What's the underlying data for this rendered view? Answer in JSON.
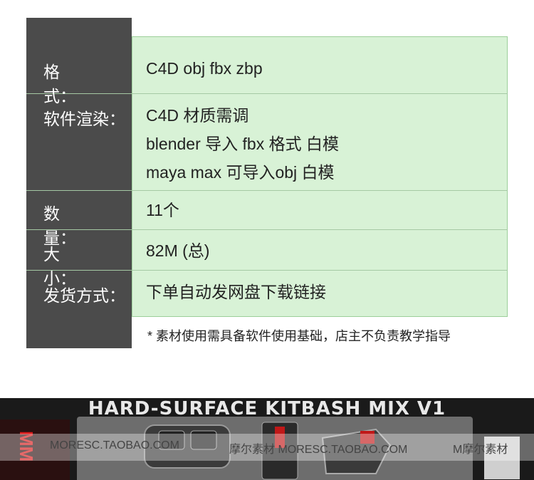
{
  "spec_table": {
    "rows": [
      {
        "label_key": "格",
        "label_colon": "式：",
        "lines": [
          "C4D   obj   fbx   zbp"
        ]
      },
      {
        "label_key": "软件渲染",
        "label_colon": "：",
        "lines": [
          "C4D  材质需调",
          "blender  导入 fbx 格式 白模",
          "maya  max  可导入obj  白模"
        ]
      },
      {
        "label_key": "数",
        "label_colon": "量：",
        "lines": [
          "11个"
        ]
      },
      {
        "label_key": "大",
        "label_colon": "小：",
        "lines": [
          "82M (总)"
        ]
      },
      {
        "label_key": "发货方式",
        "label_colon": "：",
        "lines": [
          "下单自动发网盘下载链接"
        ]
      }
    ],
    "note": "* 素材使用需具备软件使用基础，店主不负责教学指导"
  },
  "banner": {
    "title": "HARD-SURFACE KITBASH MIX V1",
    "watermarks": [
      "MORESC.TAOBAO.COM",
      "摩尔素材 MORESC.TAOBAO.COM",
      "M摩尔素材"
    ],
    "red_side_text": "MM"
  },
  "colors": {
    "sidebar": "#4b4b4b",
    "table_bg": "#d8f2d6",
    "banner_bg": "#1a1a1a"
  }
}
